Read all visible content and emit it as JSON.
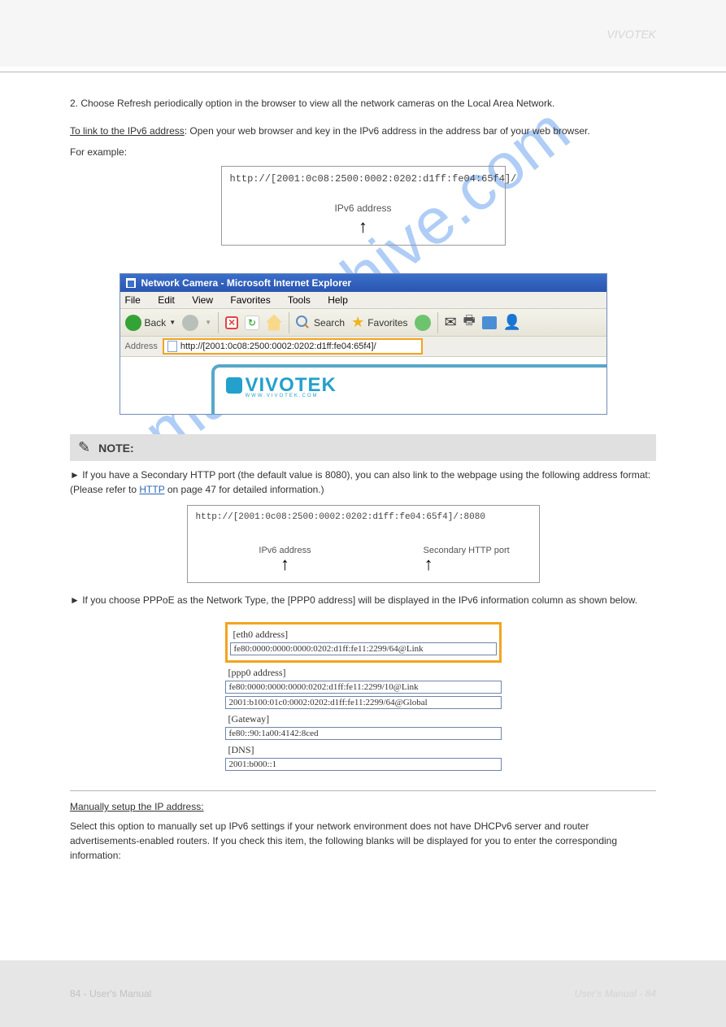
{
  "header": {
    "breadcrumb": "VIVOTEK"
  },
  "intro": {
    "para1": "2. Choose Refresh periodically option in the browser to view all the network cameras on the Local Area Network.",
    "para2": "To link to the IPv6 address: Open your web browser and key in the IPv6 address in the address bar of your web browser.",
    "example_label": "For example:"
  },
  "box1": {
    "url": "http://[2001:0c08:2500:0002:0202:d1ff:fe04:65f4]/",
    "arrow_label": "IPv6 address"
  },
  "browser": {
    "title": "Network Camera - Microsoft Internet Explorer",
    "menu": {
      "file": "File",
      "edit": "Edit",
      "view": "View",
      "favorites": "Favorites",
      "tools": "Tools",
      "help": "Help"
    },
    "toolbar": {
      "back": "Back",
      "search": "Search",
      "favorites": "Favorites"
    },
    "address_label": "Address",
    "address_value": "http://[2001:0c08:2500:0002:0202:d1ff:fe04:65f4]/",
    "logo_text": "VIVOTEK",
    "logo_sub": "WWW.VIVOTEK.COM"
  },
  "note": {
    "label": "NOTE:",
    "line1": "► If you have a Secondary HTTP port (the default value is 8080), you can also link to the webpage using the following address format:  (Please refer to ",
    "line1_link": "HTTP",
    "line1_after": " on page 47 for detailed information.)",
    "box2_url": "http://[2001:0c08:2500:0002:0202:d1ff:fe04:65f4]/:8080",
    "box2_label_left": "IPv6 address",
    "box2_label_right": "Secondary HTTP port",
    "line2": "► If you choose PPPoE as the Network Type, the [PPP0 address] will be displayed in the IPv6 information column as shown below."
  },
  "ipv6": {
    "eth0_label": "[eth0 address]",
    "eth0_val": "fe80:0000:0000:0000:0202:d1ff:fe11:2299/64@Link",
    "ppp0_label": "[ppp0 address]",
    "ppp0_val1": "fe80:0000:0000:0000:0202:d1ff:fe11:2299/10@Link",
    "ppp0_val2": "2001:b100:01c0:0002:0202:d1ff:fe11:2299/64@Global",
    "gateway_label": "[Gateway]",
    "gateway_val": "fe80::90:1a00:4142:8ced",
    "dns_label": "[DNS]",
    "dns_val": "2001:b000::1"
  },
  "manual": {
    "heading": "Manually setup the IP address:",
    "para": "Select this option to manually set up IPv6 settings if your network environment does not have DHCPv6 server and router advertisements-enabled routers. If you check this item, the following blanks will be displayed for you to enter the corresponding information:"
  },
  "footer": {
    "page": "84 - User's Manual",
    "text": "User's Manual - 84"
  },
  "watermark": "manualshive.com"
}
